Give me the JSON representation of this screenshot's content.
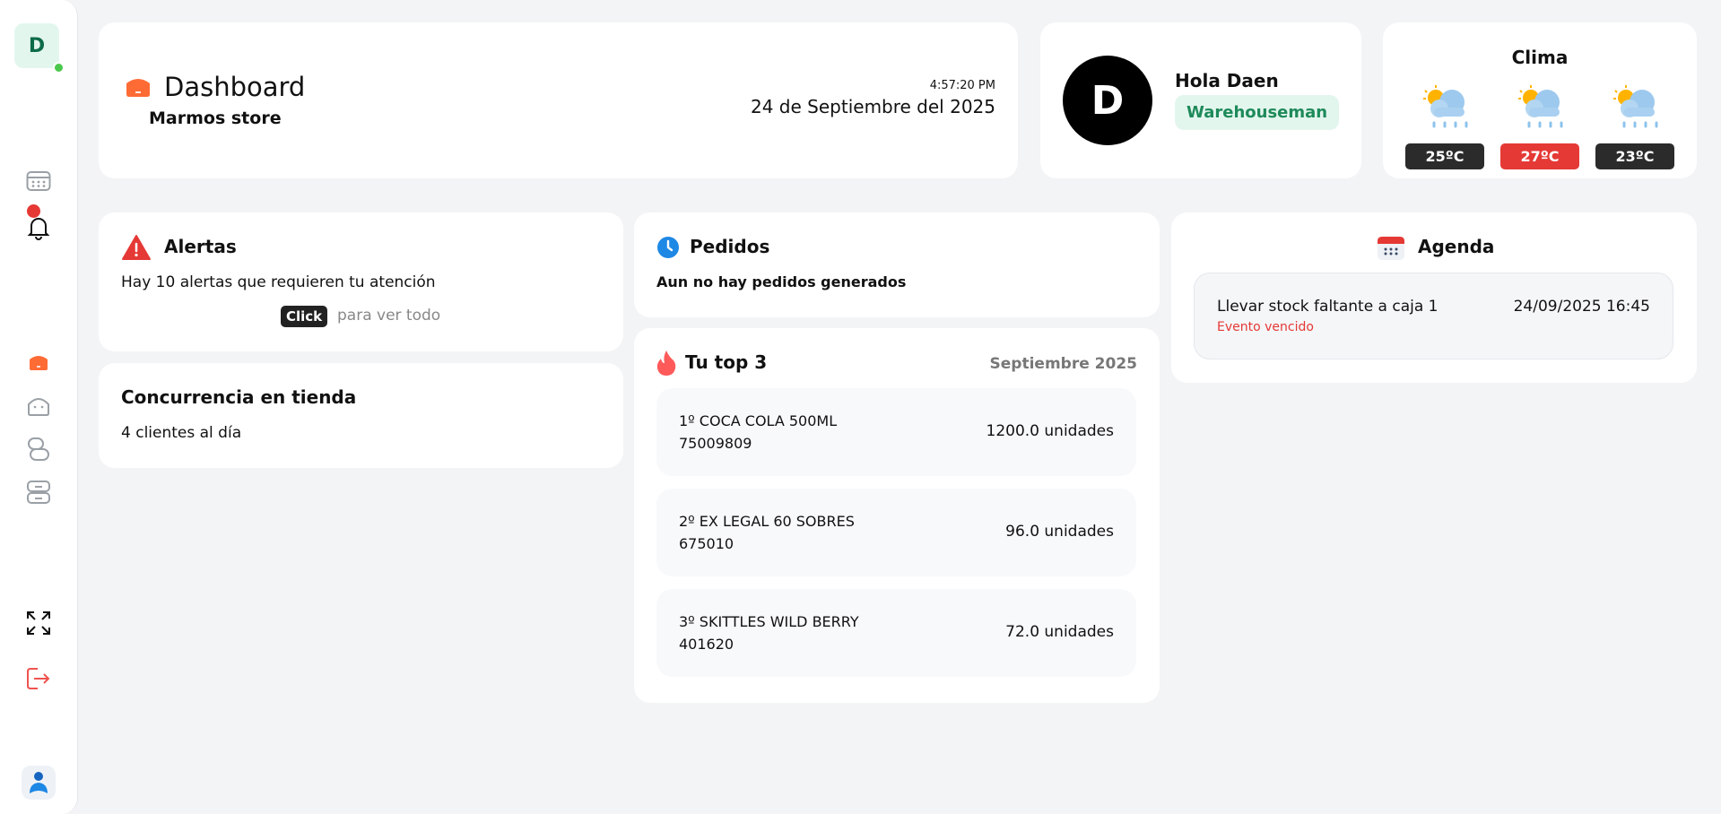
{
  "sidebar": {
    "logo_letter": "D",
    "icons": [
      "calendar-icon",
      "bell-icon",
      "home-icon",
      "bag-icon",
      "users-icon",
      "server-icon",
      "expand-icon",
      "logout-icon",
      "brand-logo-icon"
    ]
  },
  "header": {
    "title": "Dashboard",
    "store": "Marmos store",
    "time": "4:57:20 PM",
    "date": "24 de Septiembre del 2025"
  },
  "user": {
    "initial": "D",
    "greeting": "Hola Daen",
    "role": "Warehouseman"
  },
  "weather": {
    "title": "Clima",
    "days": [
      {
        "temp": "25ºC",
        "color": "#2b2b2b"
      },
      {
        "temp": "27ºC",
        "color": "#e53935"
      },
      {
        "temp": "23ºC",
        "color": "#2b2b2b"
      }
    ]
  },
  "alerts": {
    "title": "Alertas",
    "text": "Hay 10 alertas que requieren tu atención",
    "click_label": "Click",
    "click_rest": "para ver todo"
  },
  "concurrency": {
    "title": "Concurrencia en tienda",
    "text": "4 clientes al día"
  },
  "orders": {
    "title": "Pedidos",
    "text": "Aun no hay pedidos generados"
  },
  "top": {
    "title": "Tu top 3",
    "month": "Septiembre 2025",
    "items": [
      {
        "name": "1º COCA COLA 500ML",
        "code": "75009809",
        "units": "1200.0 unidades"
      },
      {
        "name": "2º EX LEGAL 60 SOBRES",
        "code": "675010",
        "units": "96.0 unidades"
      },
      {
        "name": "3º SKITTLES WILD BERRY",
        "code": "401620",
        "units": "72.0 unidades"
      }
    ]
  },
  "agenda": {
    "title": "Agenda",
    "items": [
      {
        "title": "Llevar stock faltante a caja 1",
        "status": "Evento vencido",
        "date": "24/09/2025 16:45"
      }
    ]
  },
  "colors": {
    "accent_orange": "#ff6b35",
    "badge_green": "#1e8a5a",
    "alert_red": "#e53935",
    "clock_blue": "#1e88e5"
  }
}
